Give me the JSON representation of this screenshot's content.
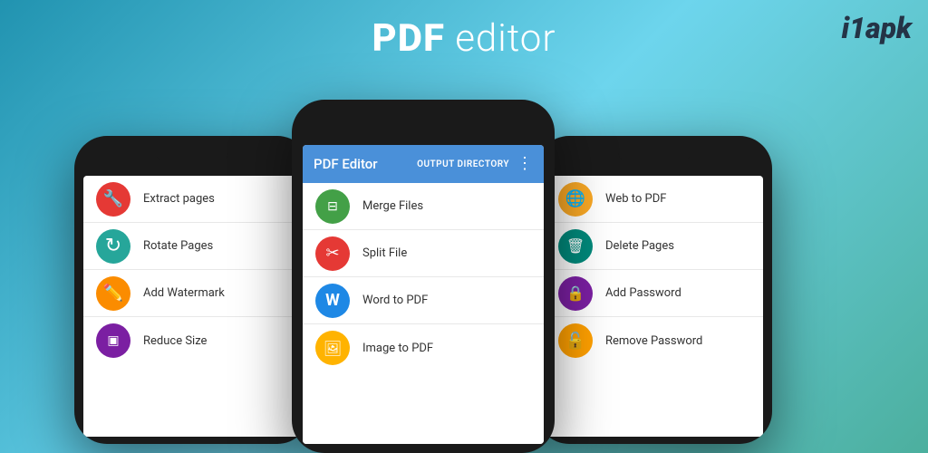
{
  "header": {
    "title_bold": "PDF",
    "title_light": " editor",
    "watermark": "i1apk"
  },
  "phones": {
    "left": {
      "items": [
        {
          "label": "Extract pages",
          "icon": "🔧",
          "color": "icon-red"
        },
        {
          "label": "Rotate Pages",
          "icon": "↻",
          "color": "icon-green-teal"
        },
        {
          "label": "Add Watermark",
          "icon": "✏️",
          "color": "icon-orange"
        },
        {
          "label": "Reduce Size",
          "icon": "⊞",
          "color": "icon-purple"
        }
      ]
    },
    "center": {
      "topbar_title": "PDF Editor",
      "topbar_action": "OUTPUT DIRECTORY",
      "items": [
        {
          "label": "Merge Files",
          "icon": "⊟",
          "color": "icon-green"
        },
        {
          "label": "Split File",
          "icon": "✂",
          "color": "icon-red-dark"
        },
        {
          "label": "Word to PDF",
          "icon": "W",
          "color": "icon-blue"
        },
        {
          "label": "Image to PDF",
          "icon": "🖼",
          "color": "icon-amber"
        }
      ]
    },
    "right": {
      "items": [
        {
          "label": "Web to PDF",
          "icon": "🌐",
          "color": "icon-yellow"
        },
        {
          "label": "Delete Pages",
          "icon": "🗑",
          "color": "icon-teal"
        },
        {
          "label": "Add Password",
          "icon": "🔒",
          "color": "icon-purple"
        },
        {
          "label": "Remove Password",
          "icon": "🔓",
          "color": "icon-gold"
        }
      ]
    }
  }
}
